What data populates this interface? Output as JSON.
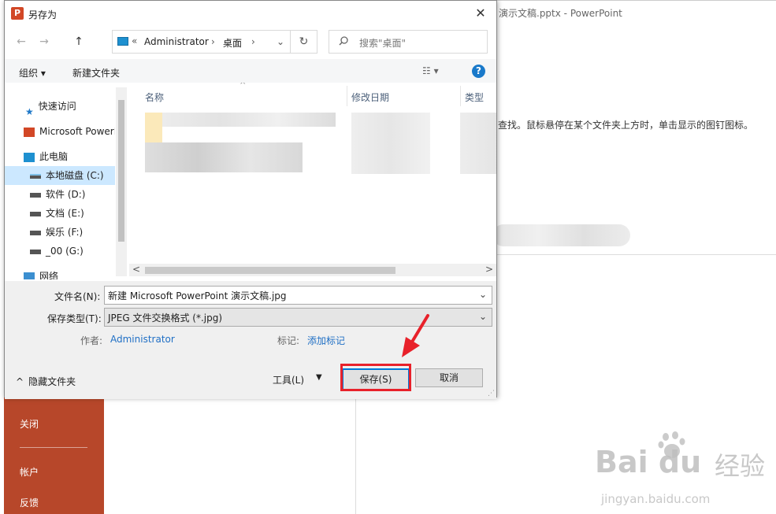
{
  "background": {
    "title": "演示文稿.pptx  -  PowerPoint",
    "hint": "查找。鼠标悬停在某个文件夹上方时，单击显示的图钉图标。",
    "sidebar": [
      "关闭",
      "帐户",
      "反馈"
    ]
  },
  "dialog": {
    "title": "另存为",
    "app_icon": "P",
    "close": "✕",
    "nav": {
      "back": "←",
      "forward": "→",
      "up": "↑"
    },
    "address": {
      "sep": "«",
      "path": [
        "Administrator",
        "桌面"
      ],
      "arrow": "›",
      "dropdown": "⌄"
    },
    "refresh": "↻",
    "search_placeholder": "搜索\"桌面\"",
    "toolbar": {
      "organize": "组织 ▾",
      "new_folder": "新建文件夹",
      "view": "☷ ▾",
      "help": "?"
    },
    "nav_pane": [
      {
        "label": "快速访问",
        "icon": "star-icon"
      },
      {
        "label": "Microsoft PowerPoint",
        "icon": "powerpoint-icon"
      },
      {
        "label": "此电脑",
        "icon": "computer-icon"
      },
      {
        "label": "本地磁盘 (C:)",
        "icon": "drive-icon",
        "selected": true
      },
      {
        "label": "软件 (D:)",
        "icon": "drive-icon"
      },
      {
        "label": "文档 (E:)",
        "icon": "drive-icon"
      },
      {
        "label": "娱乐 (F:)",
        "icon": "drive-icon"
      },
      {
        "label": "_00 (G:)",
        "icon": "drive-icon"
      },
      {
        "label": "网络",
        "icon": "network-icon"
      }
    ],
    "columns": {
      "name": "名称",
      "date": "修改日期",
      "type": "类型"
    },
    "sort_indicator": "^",
    "scroll_left": "<",
    "scroll_right": ">",
    "filename_label": "文件名(N):",
    "filename": "新建 Microsoft PowerPoint 演示文稿.jpg",
    "filetype_label": "保存类型(T):",
    "filetype": "JPEG 文件交换格式 (*.jpg)",
    "author_label": "作者:",
    "author": "Administrator",
    "tags_label": "标记:",
    "tags": "添加标记",
    "hide_folders": "隐藏文件夹",
    "hide_icon": "^",
    "tools": "工具(L)",
    "tools_dd": "▼",
    "save": "保存(S)",
    "cancel": "取消",
    "dropdown_glyph": "⌄"
  },
  "watermark": {
    "logo": "Bai  du",
    "jingyan": "经验",
    "url": "jingyan.baidu.com"
  },
  "colors": {
    "accent": "#0078d7",
    "highlight": "#e8212a",
    "ppt": "#b7472a"
  }
}
